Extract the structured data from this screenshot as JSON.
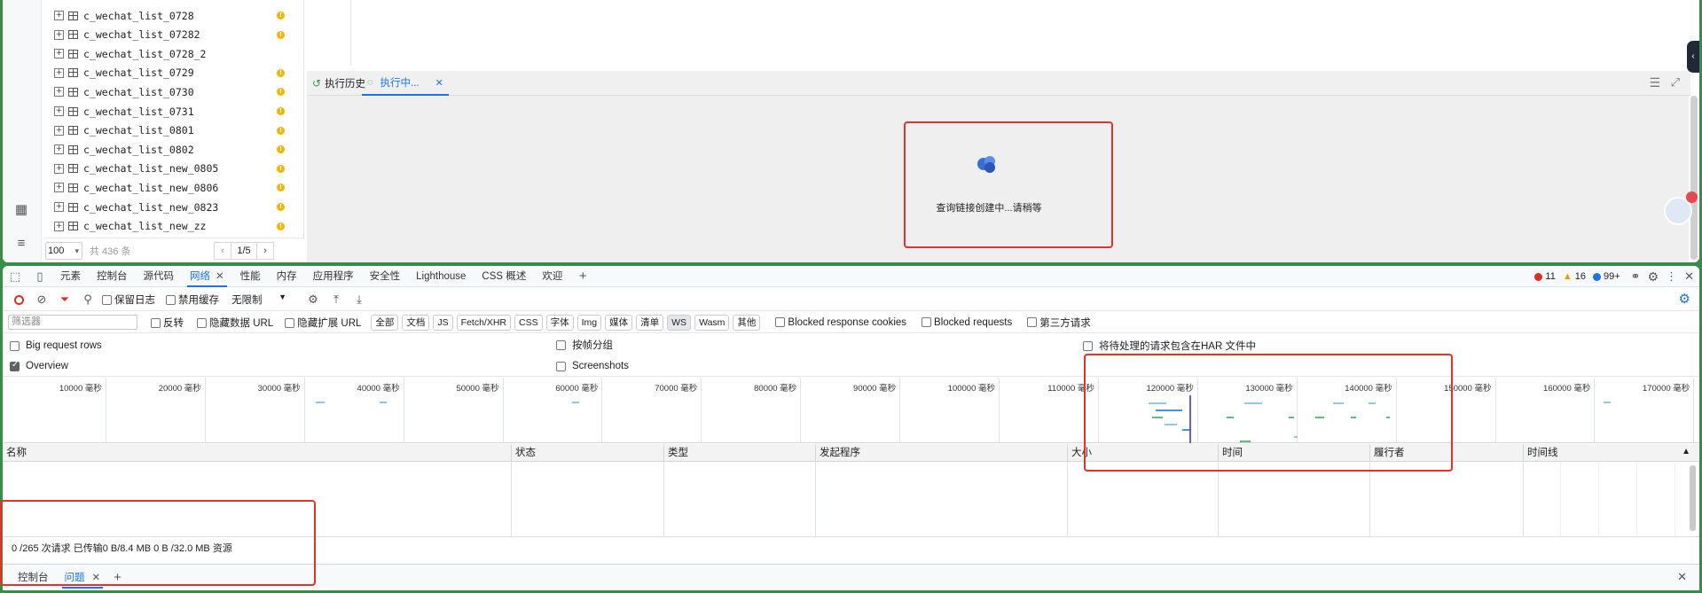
{
  "app": {
    "tree_items": [
      {
        "name": "c_wechat_list_0728",
        "warn": true
      },
      {
        "name": "c_wechat_list_07282",
        "warn": true
      },
      {
        "name": "c_wechat_list_0728_2",
        "warn": false
      },
      {
        "name": "c_wechat_list_0729",
        "warn": true
      },
      {
        "name": "c_wechat_list_0730",
        "warn": true
      },
      {
        "name": "c_wechat_list_0731",
        "warn": true
      },
      {
        "name": "c_wechat_list_0801",
        "warn": true
      },
      {
        "name": "c_wechat_list_0802",
        "warn": true
      },
      {
        "name": "c_wechat_list_new_0805",
        "warn": true
      },
      {
        "name": "c_wechat_list_new_0806",
        "warn": true
      },
      {
        "name": "c_wechat_list_new_0823",
        "warn": true
      },
      {
        "name": "c_wechat_list_new_zz",
        "warn": true
      }
    ],
    "pager": {
      "page_size": "100",
      "total": "共 436 条",
      "page": "1/5"
    },
    "exec_tabs": {
      "history": "执行历史",
      "running": "执行中..."
    },
    "loading_text": "查询链接创建中...请稍等"
  },
  "devtools": {
    "tabs": [
      "元素",
      "控制台",
      "源代码",
      "网络",
      "性能",
      "内存",
      "应用程序",
      "安全性",
      "Lighthouse",
      "CSS 概述",
      "欢迎"
    ],
    "active_tab": "网络",
    "counts": {
      "errors": "11",
      "warnings": "16",
      "info": "99+"
    },
    "toolbar": {
      "preserve_log": "保留日志",
      "disable_cache": "禁用缓存",
      "throttle": "无限制"
    },
    "filter": {
      "placeholder": "筛选器",
      "invert": "反转",
      "hide_data_url": "隐藏数据 URL",
      "hide_ext_url": "隐藏扩展 URL",
      "types": [
        "全部",
        "文档",
        "JS",
        "Fetch/XHR",
        "CSS",
        "字体",
        "Img",
        "媒体",
        "清单",
        "WS",
        "Wasm",
        "其他"
      ],
      "selected_type": "WS",
      "blocked_cookies": "Blocked response cookies",
      "blocked_requests": "Blocked requests",
      "third_party": "第三方请求"
    },
    "options": {
      "big_rows": "Big request rows",
      "group_by_frame": "按帧分组",
      "har": "将待处理的请求包含在HAR 文件中",
      "overview": "Overview",
      "screenshots": "Screenshots"
    },
    "overview_labels": [
      "10000 毫秒",
      "20000 毫秒",
      "30000 毫秒",
      "40000 毫秒",
      "50000 毫秒",
      "60000 毫秒",
      "70000 毫秒",
      "80000 毫秒",
      "90000 毫秒",
      "100000 毫秒",
      "110000 毫秒",
      "120000 毫秒",
      "130000 毫秒",
      "140000 毫秒",
      "150000 毫秒",
      "160000 毫秒",
      "170000 毫秒"
    ],
    "columns": [
      "名称",
      "状态",
      "类型",
      "发起程序",
      "大小",
      "时间",
      "履行者",
      "时间线"
    ],
    "summary": "0 /265 次请求  已传输0 B/8.4 MB  0 B /32.0 MB 资源",
    "drawer_tabs": {
      "console": "控制台",
      "issues": "问题"
    }
  }
}
